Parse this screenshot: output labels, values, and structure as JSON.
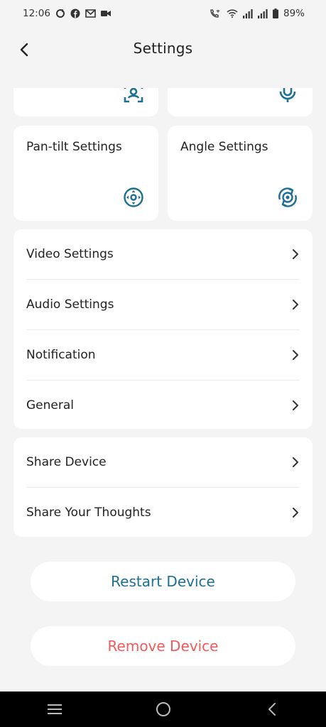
{
  "status_bar": {
    "time": "12:06",
    "battery_percent": "89%",
    "left_icons": [
      "sync-icon",
      "facebook-icon",
      "gmail-icon",
      "video-icon"
    ],
    "right_icons": [
      "wifi-call-icon",
      "wifi-icon",
      "signal-icon",
      "signal-icon",
      "battery-icon"
    ]
  },
  "header": {
    "title": "Settings",
    "back_icon": "chevron-left-icon"
  },
  "tiles": {
    "top_left_icon": "detection-icon",
    "top_right_icon": "microphone-icon",
    "pan_tilt": {
      "label": "Pan-tilt Settings",
      "icon": "pan-tilt-icon"
    },
    "angle": {
      "label": "Angle Settings",
      "icon": "angle-rotate-icon"
    }
  },
  "settings_list": {
    "items": [
      {
        "label": "Video Settings"
      },
      {
        "label": "Audio Settings"
      },
      {
        "label": "Notification"
      },
      {
        "label": "General"
      }
    ]
  },
  "share_list": {
    "items": [
      {
        "label": "Share Device"
      },
      {
        "label": "Share Your Thoughts"
      }
    ]
  },
  "actions": {
    "restart_label": "Restart Device",
    "remove_label": "Remove Device"
  },
  "colors": {
    "accent": "#1d6f94",
    "danger": "#ef5a5a",
    "background": "#f4f4f4",
    "card": "#ffffff"
  },
  "nav_bar": {
    "icons": [
      "recent-apps-icon",
      "home-icon",
      "back-icon"
    ]
  }
}
